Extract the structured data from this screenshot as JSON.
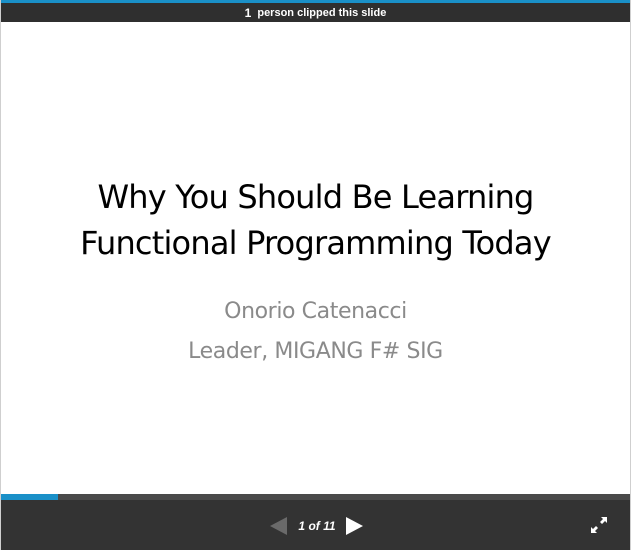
{
  "clip_bar": {
    "count": "1",
    "text": "person clipped this slide"
  },
  "slide": {
    "title_lines": [
      "Why You Should Be Learning",
      "Functional Programming Today"
    ],
    "subtitle_lines": [
      "Onorio Catenacci",
      "Leader, MIGANG F# SIG"
    ]
  },
  "controls": {
    "current_page": "1",
    "of_label": "of",
    "total_pages": "11",
    "progress_fraction": 0.09
  },
  "icons": {
    "prev": "prev-arrow-icon",
    "next": "next-arrow-icon",
    "fullscreen": "fullscreen-icon"
  },
  "colors": {
    "accent": "#1a90c8",
    "bar_background": "#2f2f2f",
    "controls_background": "#333333",
    "prev_arrow_disabled": "#6a6a6a",
    "next_arrow": "#ffffff"
  }
}
